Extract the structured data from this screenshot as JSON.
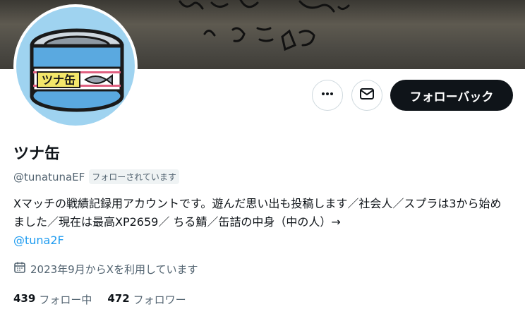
{
  "profile": {
    "display_name": "ツナ缶",
    "handle": "@tunatunaEF",
    "follows_you_badge": "フォローされています",
    "bio_text": "Xマッチの戦績記録用アカウントです。遊んだ思い出も投稿します／社会人／スプラは3から始めました／現在は最高XP2659／ ちる鯖／缶詰の中身（中の人）→",
    "bio_link": "@tuna2F",
    "joined": "2023年9月からXを利用しています",
    "avatar_label": "ツナ缶"
  },
  "actions": {
    "more_icon": "more-icon",
    "message_icon": "mail-icon",
    "follow_back_label": "フォローバック"
  },
  "stats": {
    "following_count": "439",
    "following_label": "フォロー中",
    "followers_count": "472",
    "followers_label": "フォロワー"
  },
  "colors": {
    "primary_button": "#0f1419",
    "link": "#1d9bf0",
    "secondary_text": "#536471",
    "avatar_background": "#9fd3f0"
  }
}
